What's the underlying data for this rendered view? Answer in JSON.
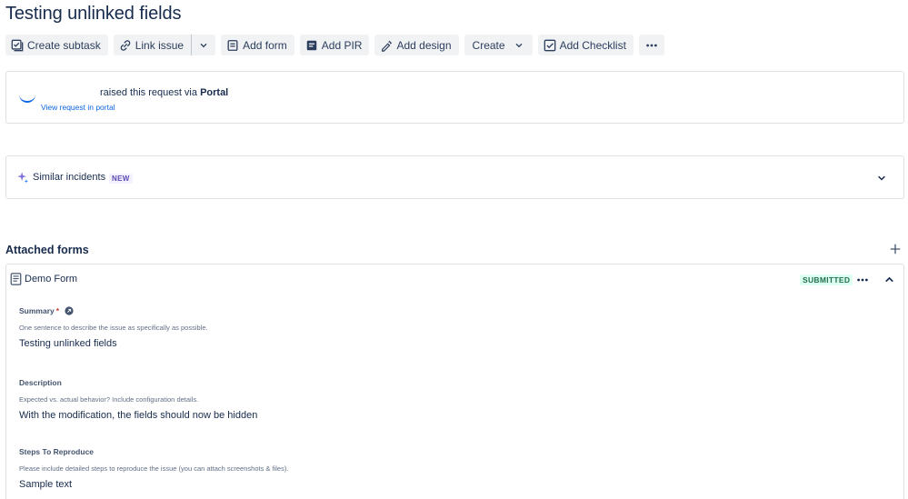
{
  "page": {
    "title": "Testing unlinked fields"
  },
  "toolbar": {
    "create_subtask": "Create subtask",
    "link_issue": "Link issue",
    "add_form": "Add form",
    "add_pir": "Add PIR",
    "add_design": "Add design",
    "create": "Create",
    "add_checklist": "Add Checklist"
  },
  "request": {
    "raised_prefix": "raised this request via",
    "channel": "Portal",
    "view_link": "View request in portal"
  },
  "incidents": {
    "label": "Similar incidents",
    "badge": "NEW"
  },
  "attached_forms": {
    "title": "Attached forms",
    "form_name": "Demo Form",
    "status": "SUBMITTED",
    "status_color": "#216e4e",
    "fields": [
      {
        "label": "Summary",
        "required": "*",
        "help": "One sentence to describe the issue as specifically as possible.",
        "value": "Testing unlinked fields"
      },
      {
        "label": "Description",
        "help": "Expected vs. actual behavior? Include configuration details.",
        "value": "With the modification, the fields should now be hidden"
      },
      {
        "label": "Steps To Reproduce",
        "help": "Please include detailed steps to reproduce the issue (you can attach screenshots & files).",
        "value": "Sample text"
      }
    ]
  },
  "colors": {
    "accent": "#0c66e4",
    "new_badge": "#5e4db2",
    "text": "#172b4d"
  }
}
